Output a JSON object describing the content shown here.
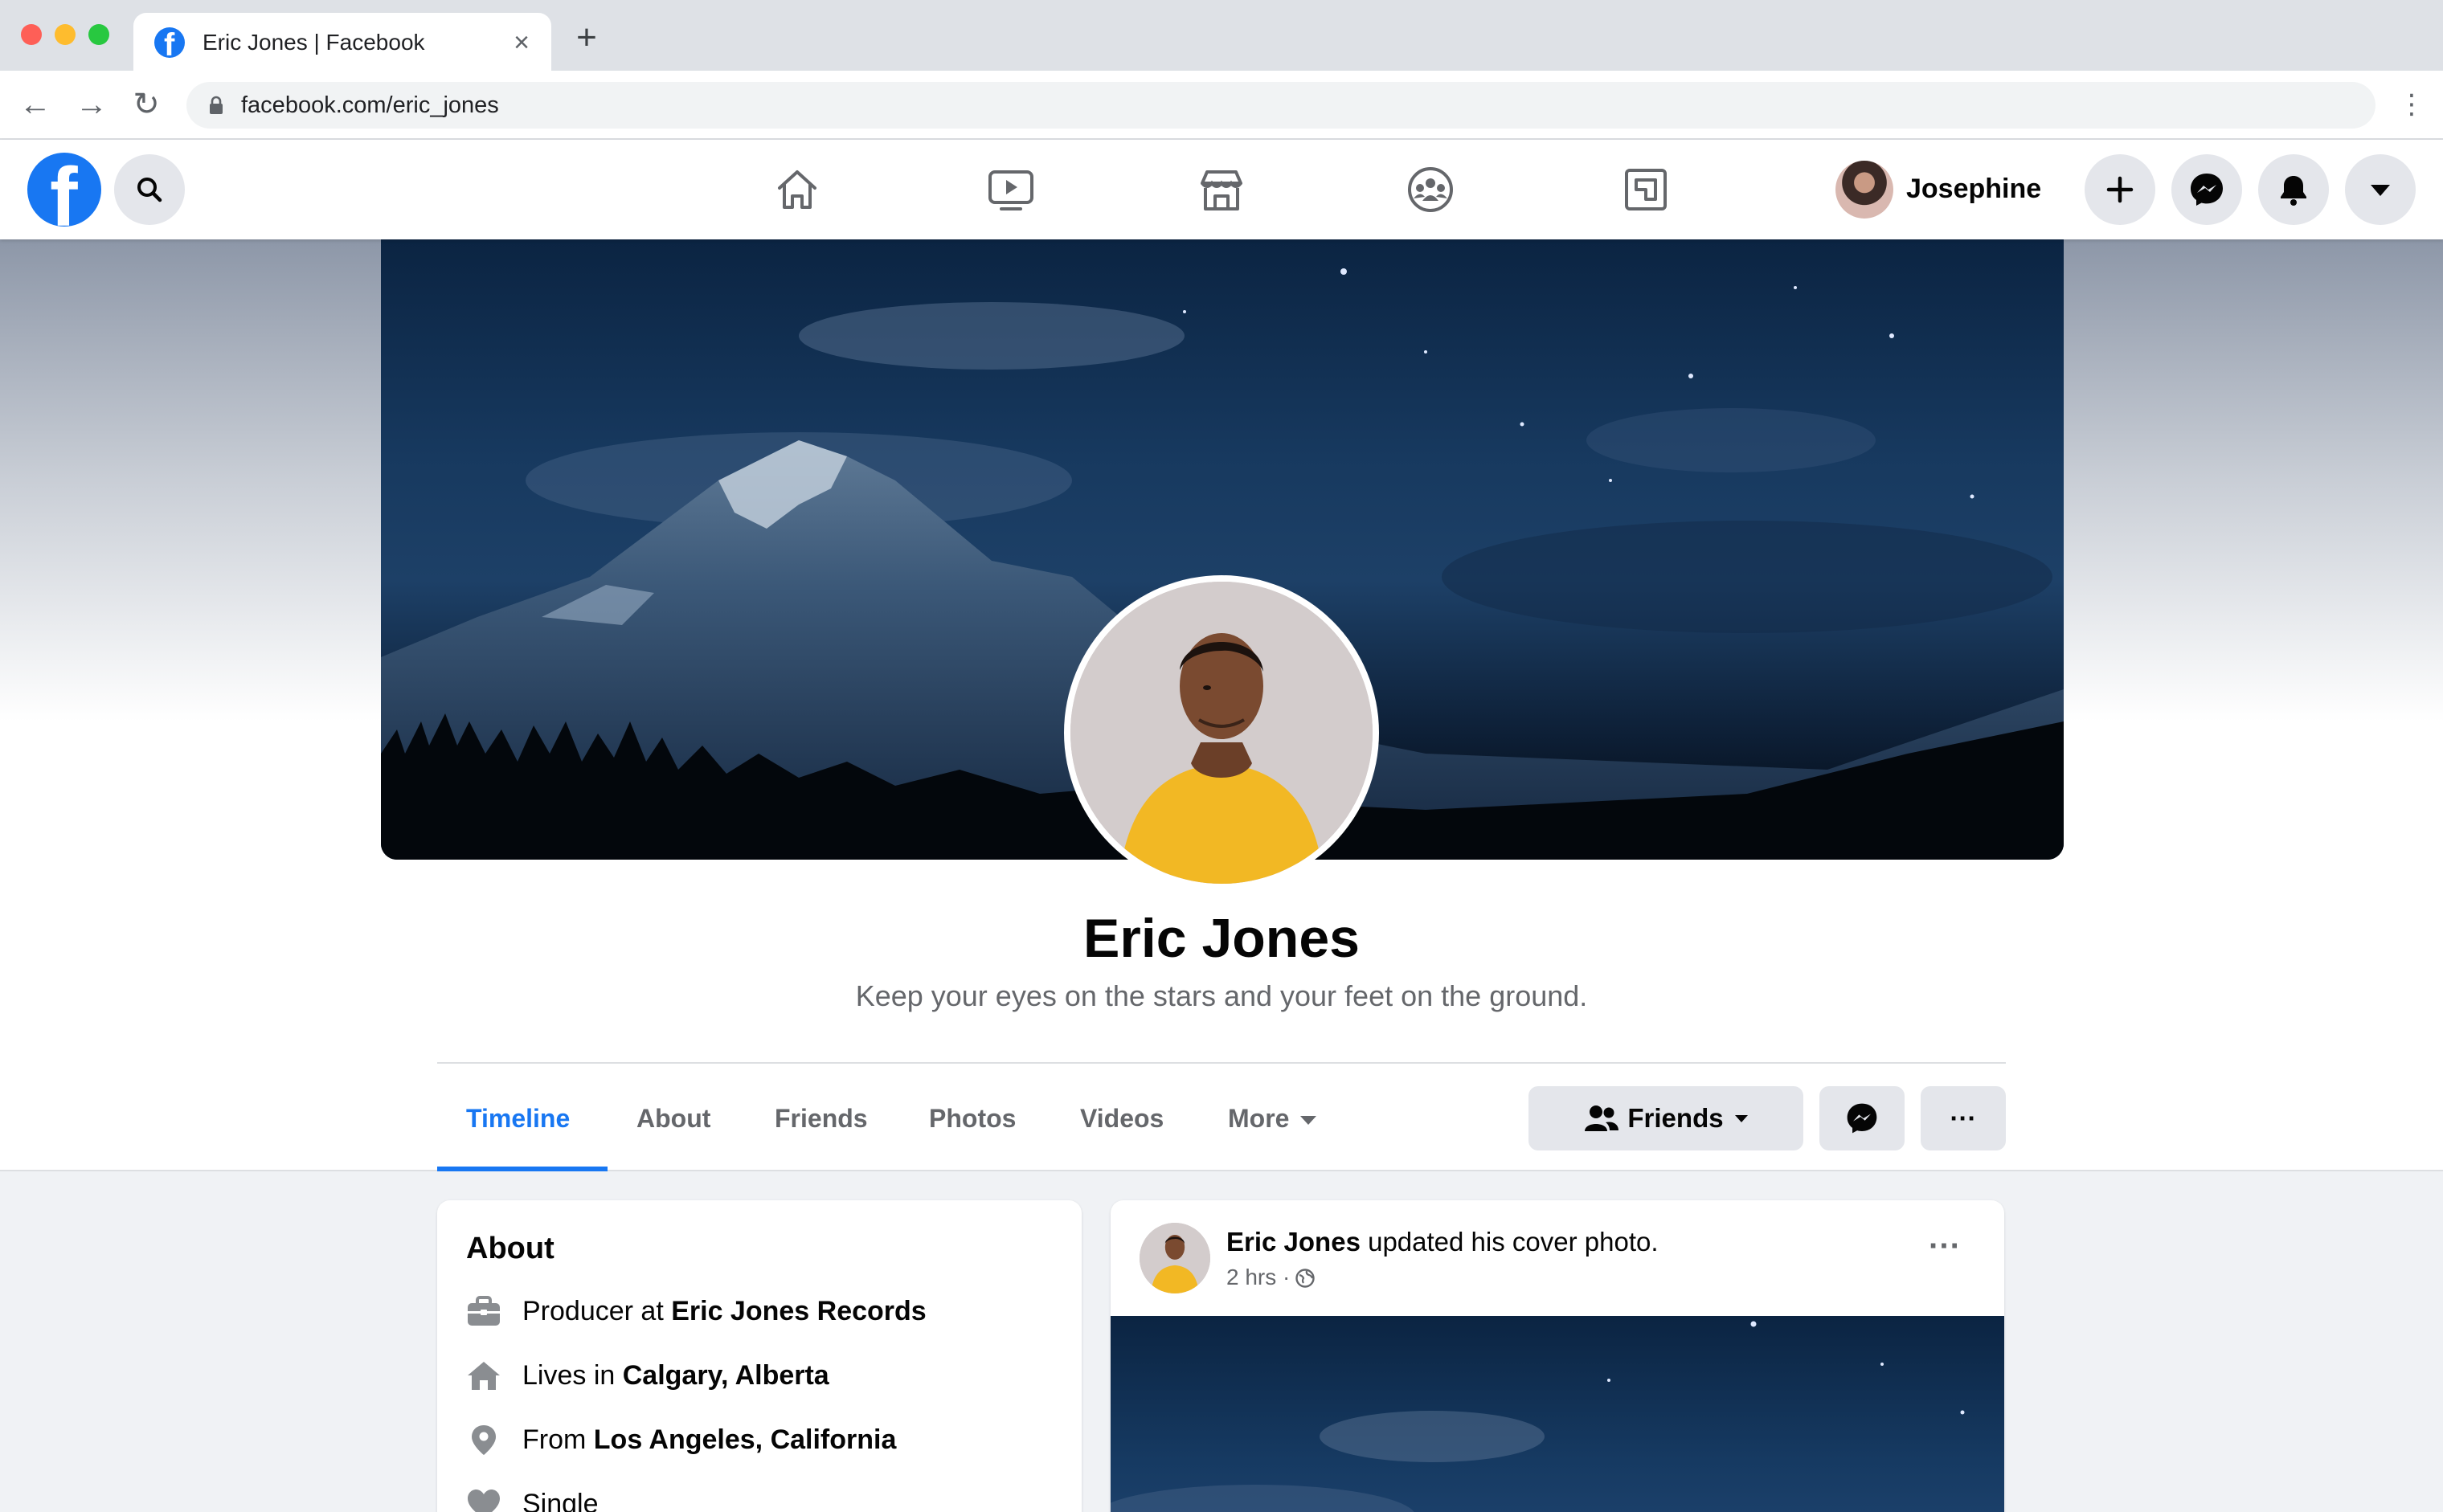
{
  "browser": {
    "tab_title": "Eric Jones | Facebook",
    "tab_close": "×",
    "new_tab": "+",
    "url": "facebook.com/eric_jones",
    "back": "←",
    "forward": "→",
    "reload": "↻",
    "menu": "⋮"
  },
  "fbnav": {
    "logo_letter": "f",
    "icons": [
      "home-icon",
      "watch-icon",
      "marketplace-icon",
      "groups-icon",
      "gaming-icon"
    ],
    "user_name": "Josephine",
    "create_label": "+"
  },
  "profile": {
    "name": "Eric Jones",
    "bio": "Keep your eyes on the stars and your feet on the ground.",
    "tabs": [
      {
        "label": "Timeline",
        "active": true
      },
      {
        "label": "About",
        "active": false
      },
      {
        "label": "Friends",
        "active": false
      },
      {
        "label": "Photos",
        "active": false
      },
      {
        "label": "Videos",
        "active": false
      },
      {
        "label": "More",
        "active": false
      }
    ],
    "friends_button": "Friends",
    "more_button": "···"
  },
  "about": {
    "title": "About",
    "items": [
      {
        "icon": "briefcase-icon",
        "prefix": "Producer at ",
        "value": "Eric Jones Records"
      },
      {
        "icon": "house-icon",
        "prefix": "Lives in ",
        "value": "Calgary, Alberta"
      },
      {
        "icon": "location-pin-icon",
        "prefix": "From ",
        "value": "Los Angeles, California"
      },
      {
        "icon": "heart-icon",
        "prefix": "",
        "value": "Single"
      }
    ]
  },
  "post": {
    "author": "Eric Jones",
    "action": " updated his cover photo.",
    "time": "2 hrs ·",
    "more": "···"
  },
  "colors": {
    "accent": "#1877f2",
    "secondary_text": "#65676b",
    "button_gray": "#e4e6eb",
    "page_bg": "#f0f2f5"
  }
}
